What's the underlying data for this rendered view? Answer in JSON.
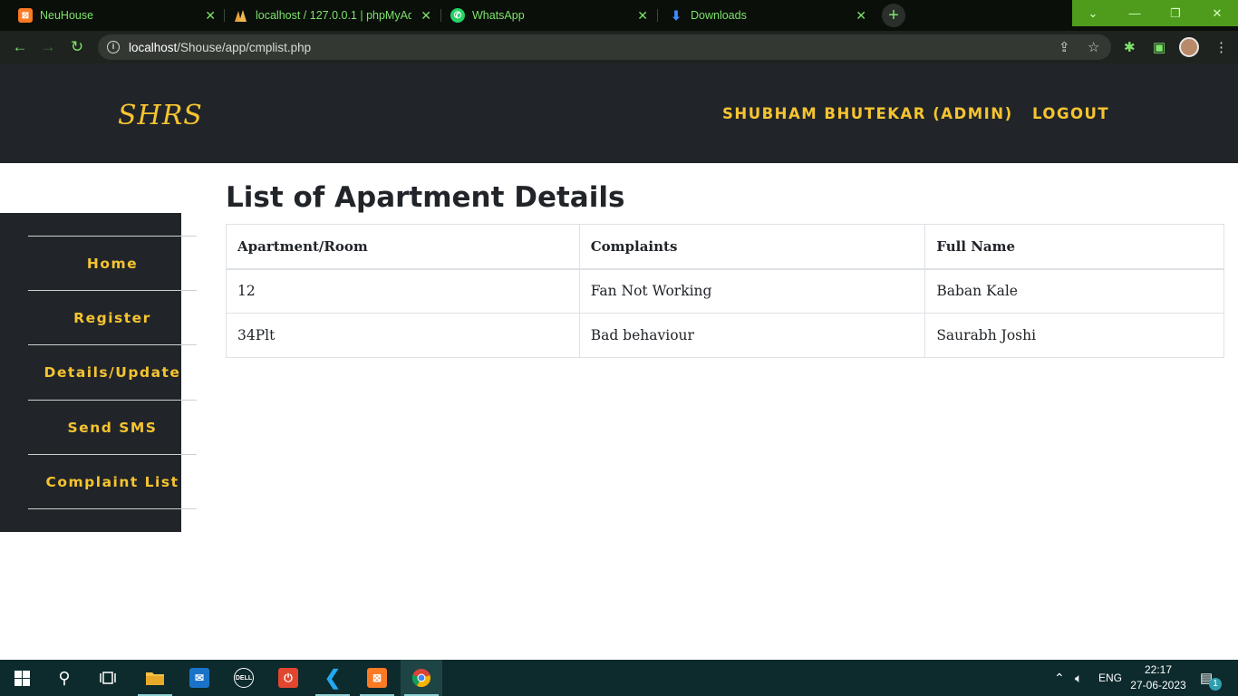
{
  "browser": {
    "tabs": [
      {
        "title": "NeuHouse",
        "icon": "xampp-icon"
      },
      {
        "title": "localhost / 127.0.0.1 | phpMyAdmin",
        "icon": "phpmyadmin-icon"
      },
      {
        "title": "WhatsApp",
        "icon": "whatsapp-icon"
      },
      {
        "title": "Downloads",
        "icon": "download-icon"
      }
    ],
    "url_host": "localhost",
    "url_path": "/Shouse/app/cmplist.php",
    "accent": "#7de36a"
  },
  "site": {
    "logo": "SHRS",
    "user_label": "SHUBHAM BHUTEKAR (ADMIN)",
    "logout_label": "LOGOUT",
    "accent": "#f6c431",
    "dark": "#212529"
  },
  "sidebar": {
    "items": [
      {
        "label": "Home"
      },
      {
        "label": "Register"
      },
      {
        "label": "Details/Update"
      },
      {
        "label": "Send SMS"
      },
      {
        "label": "Complaint List"
      }
    ]
  },
  "main": {
    "title": "List of Apartment Details",
    "columns": [
      "Apartment/Room",
      "Complaints",
      "Full Name"
    ],
    "rows": [
      [
        "12",
        "Fan Not Working",
        "Baban Kale"
      ],
      [
        "34Plt",
        "Bad behaviour",
        "Saurabh Joshi"
      ]
    ]
  },
  "taskbar": {
    "language": "ENG",
    "time": "22:17",
    "date": "27-06-2023",
    "notifications": "1"
  }
}
